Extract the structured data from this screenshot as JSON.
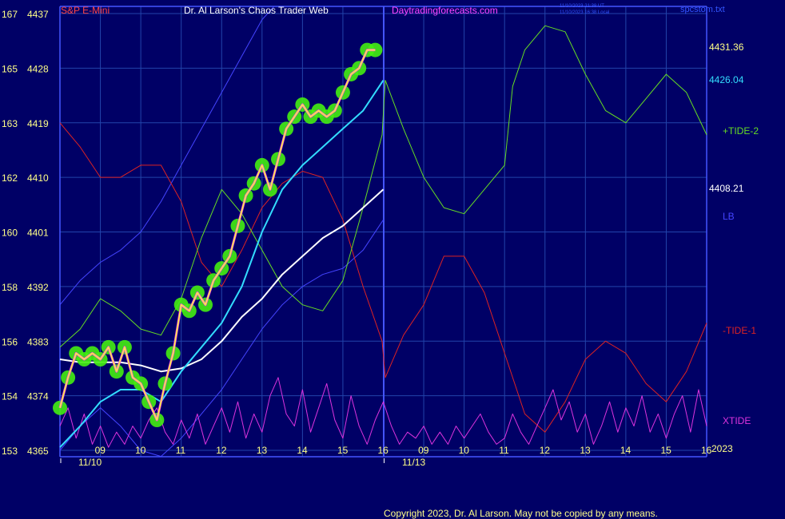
{
  "header": {
    "symbol": "S&P E-Mini",
    "title": "Dr. Al Larson's Chaos Trader Web",
    "site": "Daytradingforecasts.com",
    "timestamp_utc": "11/10/2023 21:38 UT",
    "timestamp_local": "11/10/2023 16:38 Local",
    "file": "spcstom.txt"
  },
  "colors": {
    "background": "#000066",
    "grid": "#2244aa",
    "price_axis_text": "#ffff88",
    "tide1": "#dd2222",
    "tide2": "#66dd22",
    "xtide": "#dd33dd",
    "lb": "#4444ff",
    "cyan_avg": "#33ddff",
    "white_avg": "#ffffff",
    "price_glow": "#44ee11",
    "price_line": "#ffff33",
    "symbol_color": "#ff4444",
    "site_color": "#ff44ff",
    "copyright_color": "#ffff88"
  },
  "chart_data": {
    "type": "line",
    "title": "S&P E-Mini",
    "y_left_outer_ticks": [
      "167",
      "165",
      "163",
      "162",
      "160",
      "158",
      "156",
      "154",
      "153"
    ],
    "y_left_price_ticks": [
      "4437",
      "4428",
      "4419",
      "4410",
      "4401",
      "4392",
      "4383",
      "4374",
      "4365"
    ],
    "ylim": [
      4365,
      4437
    ],
    "x_hour_labels_day1": [
      "09",
      "10",
      "11",
      "12",
      "13",
      "14",
      "15",
      "16"
    ],
    "x_hour_labels_day2": [
      "09",
      "10",
      "11",
      "12",
      "13",
      "14",
      "15",
      "16"
    ],
    "date_labels": [
      "11/10",
      "11/13"
    ],
    "year_label": "2023",
    "right_values": {
      "price_last": "4431.36",
      "cyan_last": "4426.04",
      "white_last": "4408.21"
    },
    "series_labels": [
      "+TIDE-2",
      "LB",
      "-TIDE-1",
      "XTIDE"
    ],
    "price_series": [
      {
        "t": 0.0,
        "v": 4372
      },
      {
        "t": 0.2,
        "v": 4377
      },
      {
        "t": 0.4,
        "v": 4381
      },
      {
        "t": 0.6,
        "v": 4380
      },
      {
        "t": 0.8,
        "v": 4381
      },
      {
        "t": 1.0,
        "v": 4380
      },
      {
        "t": 1.2,
        "v": 4382
      },
      {
        "t": 1.4,
        "v": 4378
      },
      {
        "t": 1.6,
        "v": 4382
      },
      {
        "t": 1.8,
        "v": 4377
      },
      {
        "t": 2.0,
        "v": 4376
      },
      {
        "t": 2.2,
        "v": 4373
      },
      {
        "t": 2.4,
        "v": 4370
      },
      {
        "t": 2.6,
        "v": 4376
      },
      {
        "t": 2.8,
        "v": 4381
      },
      {
        "t": 3.0,
        "v": 4389
      },
      {
        "t": 3.2,
        "v": 4388
      },
      {
        "t": 3.4,
        "v": 4391
      },
      {
        "t": 3.6,
        "v": 4389
      },
      {
        "t": 3.8,
        "v": 4393
      },
      {
        "t": 4.0,
        "v": 4395
      },
      {
        "t": 4.2,
        "v": 4397
      },
      {
        "t": 4.4,
        "v": 4402
      },
      {
        "t": 4.6,
        "v": 4407
      },
      {
        "t": 4.8,
        "v": 4409
      },
      {
        "t": 5.0,
        "v": 4412
      },
      {
        "t": 5.2,
        "v": 4408
      },
      {
        "t": 5.4,
        "v": 4413
      },
      {
        "t": 5.6,
        "v": 4418
      },
      {
        "t": 5.8,
        "v": 4420
      },
      {
        "t": 6.0,
        "v": 4422
      },
      {
        "t": 6.2,
        "v": 4420
      },
      {
        "t": 6.4,
        "v": 4421
      },
      {
        "t": 6.6,
        "v": 4420
      },
      {
        "t": 6.8,
        "v": 4421
      },
      {
        "t": 7.0,
        "v": 4424
      },
      {
        "t": 7.2,
        "v": 4427
      },
      {
        "t": 7.4,
        "v": 4428
      },
      {
        "t": 7.6,
        "v": 4431
      },
      {
        "t": 7.8,
        "v": 4431
      }
    ],
    "cyan_series": [
      {
        "t": 0.0,
        "v": 4365.5
      },
      {
        "t": 0.5,
        "v": 4369
      },
      {
        "t": 1.0,
        "v": 4373
      },
      {
        "t": 1.5,
        "v": 4375
      },
      {
        "t": 2.0,
        "v": 4375
      },
      {
        "t": 2.5,
        "v": 4373
      },
      {
        "t": 3.0,
        "v": 4378
      },
      {
        "t": 3.5,
        "v": 4382
      },
      {
        "t": 4.0,
        "v": 4386
      },
      {
        "t": 4.5,
        "v": 4392
      },
      {
        "t": 5.0,
        "v": 4401
      },
      {
        "t": 5.5,
        "v": 4408
      },
      {
        "t": 6.0,
        "v": 4412
      },
      {
        "t": 6.5,
        "v": 4415
      },
      {
        "t": 7.0,
        "v": 4418
      },
      {
        "t": 7.5,
        "v": 4421
      },
      {
        "t": 8.0,
        "v": 4426
      }
    ],
    "white_series": [
      {
        "t": 0.0,
        "v": 4380
      },
      {
        "t": 0.5,
        "v": 4379.5
      },
      {
        "t": 1.0,
        "v": 4379.5
      },
      {
        "t": 1.5,
        "v": 4379.5
      },
      {
        "t": 2.0,
        "v": 4379
      },
      {
        "t": 2.5,
        "v": 4378
      },
      {
        "t": 3.0,
        "v": 4378.5
      },
      {
        "t": 3.5,
        "v": 4380
      },
      {
        "t": 4.0,
        "v": 4383
      },
      {
        "t": 4.5,
        "v": 4387
      },
      {
        "t": 5.0,
        "v": 4390
      },
      {
        "t": 5.5,
        "v": 4394
      },
      {
        "t": 6.0,
        "v": 4397
      },
      {
        "t": 6.5,
        "v": 4400
      },
      {
        "t": 7.0,
        "v": 4402
      },
      {
        "t": 7.5,
        "v": 4405
      },
      {
        "t": 8.0,
        "v": 4408
      }
    ],
    "tide2_series": [
      {
        "t": 0.0,
        "v": 4382
      },
      {
        "t": 0.5,
        "v": 4385
      },
      {
        "t": 1.0,
        "v": 4390
      },
      {
        "t": 1.5,
        "v": 4388
      },
      {
        "t": 2.0,
        "v": 4385
      },
      {
        "t": 2.5,
        "v": 4384
      },
      {
        "t": 3.0,
        "v": 4390
      },
      {
        "t": 3.5,
        "v": 4400
      },
      {
        "t": 4.0,
        "v": 4408
      },
      {
        "t": 4.5,
        "v": 4404
      },
      {
        "t": 5.0,
        "v": 4398
      },
      {
        "t": 5.5,
        "v": 4392
      },
      {
        "t": 6.0,
        "v": 4389
      },
      {
        "t": 6.5,
        "v": 4388
      },
      {
        "t": 7.0,
        "v": 4393
      },
      {
        "t": 7.5,
        "v": 4405
      },
      {
        "t": 7.97,
        "v": 4417
      },
      {
        "t": 8.05,
        "v": 4426
      },
      {
        "t": 8.5,
        "v": 4418
      },
      {
        "t": 9.0,
        "v": 4410
      },
      {
        "t": 9.5,
        "v": 4405
      },
      {
        "t": 10.0,
        "v": 4404
      },
      {
        "t": 10.5,
        "v": 4408
      },
      {
        "t": 11.0,
        "v": 4412
      },
      {
        "t": 11.2,
        "v": 4425
      },
      {
        "t": 11.5,
        "v": 4431
      },
      {
        "t": 12.0,
        "v": 4435
      },
      {
        "t": 12.5,
        "v": 4434
      },
      {
        "t": 13.0,
        "v": 4427
      },
      {
        "t": 13.5,
        "v": 4421
      },
      {
        "t": 14.0,
        "v": 4419
      },
      {
        "t": 14.5,
        "v": 4423
      },
      {
        "t": 15.0,
        "v": 4427
      },
      {
        "t": 15.5,
        "v": 4424
      },
      {
        "t": 16.0,
        "v": 4417
      }
    ],
    "tide1_series": [
      {
        "t": 0.0,
        "v": 4419
      },
      {
        "t": 0.5,
        "v": 4415
      },
      {
        "t": 1.0,
        "v": 4410
      },
      {
        "t": 1.5,
        "v": 4410
      },
      {
        "t": 2.0,
        "v": 4412
      },
      {
        "t": 2.5,
        "v": 4412
      },
      {
        "t": 3.0,
        "v": 4406
      },
      {
        "t": 3.5,
        "v": 4396
      },
      {
        "t": 4.0,
        "v": 4392
      },
      {
        "t": 4.5,
        "v": 4398
      },
      {
        "t": 5.0,
        "v": 4405
      },
      {
        "t": 5.5,
        "v": 4409
      },
      {
        "t": 6.0,
        "v": 4411
      },
      {
        "t": 6.5,
        "v": 4410
      },
      {
        "t": 7.0,
        "v": 4403
      },
      {
        "t": 7.5,
        "v": 4392
      },
      {
        "t": 7.97,
        "v": 4383
      },
      {
        "t": 8.05,
        "v": 4377
      },
      {
        "t": 8.5,
        "v": 4384
      },
      {
        "t": 9.0,
        "v": 4389
      },
      {
        "t": 9.5,
        "v": 4397
      },
      {
        "t": 10.0,
        "v": 4397
      },
      {
        "t": 10.5,
        "v": 4391
      },
      {
        "t": 11.0,
        "v": 4381
      },
      {
        "t": 11.5,
        "v": 4371
      },
      {
        "t": 12.0,
        "v": 4368
      },
      {
        "t": 12.5,
        "v": 4373
      },
      {
        "t": 13.0,
        "v": 4380
      },
      {
        "t": 13.5,
        "v": 4383
      },
      {
        "t": 14.0,
        "v": 4381
      },
      {
        "t": 14.5,
        "v": 4376
      },
      {
        "t": 15.0,
        "v": 4373
      },
      {
        "t": 15.5,
        "v": 4378
      },
      {
        "t": 16.0,
        "v": 4386
      }
    ],
    "lb_series": [
      {
        "t": 0.0,
        "v": 4389
      },
      {
        "t": 0.5,
        "v": 4393
      },
      {
        "t": 1.0,
        "v": 4396
      },
      {
        "t": 1.5,
        "v": 4398
      },
      {
        "t": 2.0,
        "v": 4401
      },
      {
        "t": 2.5,
        "v": 4406
      },
      {
        "t": 3.0,
        "v": 4412
      },
      {
        "t": 3.5,
        "v": 4418
      },
      {
        "t": 4.0,
        "v": 4424
      },
      {
        "t": 4.5,
        "v": 4430
      },
      {
        "t": 5.0,
        "v": 4436
      },
      {
        "t": 5.3,
        "v": 4440
      }
    ],
    "lb_lower_series": [
      {
        "t": 0.0,
        "v": 4365
      },
      {
        "t": 0.5,
        "v": 4369
      },
      {
        "t": 1.0,
        "v": 4372
      },
      {
        "t": 1.5,
        "v": 4369
      },
      {
        "t": 2.0,
        "v": 4365
      },
      {
        "t": 2.5,
        "v": 4364
      },
      {
        "t": 3.0,
        "v": 4367
      },
      {
        "t": 3.5,
        "v": 4371
      },
      {
        "t": 4.0,
        "v": 4375
      },
      {
        "t": 4.5,
        "v": 4380
      },
      {
        "t": 5.0,
        "v": 4385
      },
      {
        "t": 5.5,
        "v": 4389
      },
      {
        "t": 6.0,
        "v": 4392
      },
      {
        "t": 6.5,
        "v": 4394
      },
      {
        "t": 7.0,
        "v": 4395
      },
      {
        "t": 7.5,
        "v": 4398
      },
      {
        "t": 8.0,
        "v": 4403
      }
    ],
    "xtide_series": [
      {
        "t": 0.0,
        "v": 4369
      },
      {
        "t": 0.2,
        "v": 4372
      },
      {
        "t": 0.4,
        "v": 4367
      },
      {
        "t": 0.6,
        "v": 4371
      },
      {
        "t": 0.8,
        "v": 4366
      },
      {
        "t": 1.0,
        "v": 4369
      },
      {
        "t": 1.2,
        "v": 4365.5
      },
      {
        "t": 1.4,
        "v": 4368
      },
      {
        "t": 1.6,
        "v": 4366
      },
      {
        "t": 1.8,
        "v": 4369
      },
      {
        "t": 2.0,
        "v": 4367
      },
      {
        "t": 2.2,
        "v": 4370
      },
      {
        "t": 2.4,
        "v": 4372
      },
      {
        "t": 2.6,
        "v": 4368
      },
      {
        "t": 2.8,
        "v": 4366
      },
      {
        "t": 3.0,
        "v": 4370
      },
      {
        "t": 3.2,
        "v": 4367
      },
      {
        "t": 3.4,
        "v": 4371
      },
      {
        "t": 3.6,
        "v": 4366
      },
      {
        "t": 3.8,
        "v": 4369
      },
      {
        "t": 4.0,
        "v": 4372
      },
      {
        "t": 4.2,
        "v": 4368
      },
      {
        "t": 4.4,
        "v": 4373
      },
      {
        "t": 4.6,
        "v": 4367
      },
      {
        "t": 4.8,
        "v": 4371
      },
      {
        "t": 5.0,
        "v": 4368
      },
      {
        "t": 5.2,
        "v": 4374
      },
      {
        "t": 5.4,
        "v": 4377
      },
      {
        "t": 5.6,
        "v": 4371
      },
      {
        "t": 5.8,
        "v": 4369
      },
      {
        "t": 6.0,
        "v": 4375
      },
      {
        "t": 6.2,
        "v": 4368
      },
      {
        "t": 6.4,
        "v": 4372
      },
      {
        "t": 6.6,
        "v": 4376
      },
      {
        "t": 6.8,
        "v": 4370
      },
      {
        "t": 7.0,
        "v": 4367
      },
      {
        "t": 7.2,
        "v": 4374
      },
      {
        "t": 7.4,
        "v": 4369
      },
      {
        "t": 7.6,
        "v": 4366
      },
      {
        "t": 7.8,
        "v": 4370
      },
      {
        "t": 8.0,
        "v": 4373
      },
      {
        "t": 8.2,
        "v": 4369
      },
      {
        "t": 8.4,
        "v": 4366
      },
      {
        "t": 8.6,
        "v": 4368
      },
      {
        "t": 8.8,
        "v": 4367
      },
      {
        "t": 9.0,
        "v": 4369
      },
      {
        "t": 9.2,
        "v": 4366
      },
      {
        "t": 9.4,
        "v": 4368
      },
      {
        "t": 9.6,
        "v": 4366
      },
      {
        "t": 9.8,
        "v": 4369
      },
      {
        "t": 10.0,
        "v": 4367
      },
      {
        "t": 10.2,
        "v": 4369
      },
      {
        "t": 10.4,
        "v": 4371
      },
      {
        "t": 10.6,
        "v": 4368
      },
      {
        "t": 10.8,
        "v": 4366
      },
      {
        "t": 11.0,
        "v": 4367
      },
      {
        "t": 11.2,
        "v": 4371
      },
      {
        "t": 11.4,
        "v": 4368
      },
      {
        "t": 11.6,
        "v": 4366
      },
      {
        "t": 11.8,
        "v": 4369
      },
      {
        "t": 12.0,
        "v": 4372
      },
      {
        "t": 12.2,
        "v": 4375
      },
      {
        "t": 12.4,
        "v": 4370
      },
      {
        "t": 12.6,
        "v": 4373
      },
      {
        "t": 12.8,
        "v": 4368
      },
      {
        "t": 13.0,
        "v": 4371
      },
      {
        "t": 13.2,
        "v": 4366
      },
      {
        "t": 13.4,
        "v": 4369
      },
      {
        "t": 13.6,
        "v": 4373
      },
      {
        "t": 13.8,
        "v": 4368
      },
      {
        "t": 14.0,
        "v": 4372
      },
      {
        "t": 14.2,
        "v": 4369
      },
      {
        "t": 14.4,
        "v": 4374
      },
      {
        "t": 14.6,
        "v": 4368
      },
      {
        "t": 14.8,
        "v": 4371
      },
      {
        "t": 15.0,
        "v": 4367
      },
      {
        "t": 15.2,
        "v": 4371
      },
      {
        "t": 15.4,
        "v": 4374
      },
      {
        "t": 15.6,
        "v": 4368
      },
      {
        "t": 15.8,
        "v": 4375
      },
      {
        "t": 16.0,
        "v": 4369
      }
    ],
    "grid": true,
    "legend": "right"
  },
  "footer": {
    "copyright": "Copyright 2023, Dr. Al Larson. May not be copied by any means."
  }
}
